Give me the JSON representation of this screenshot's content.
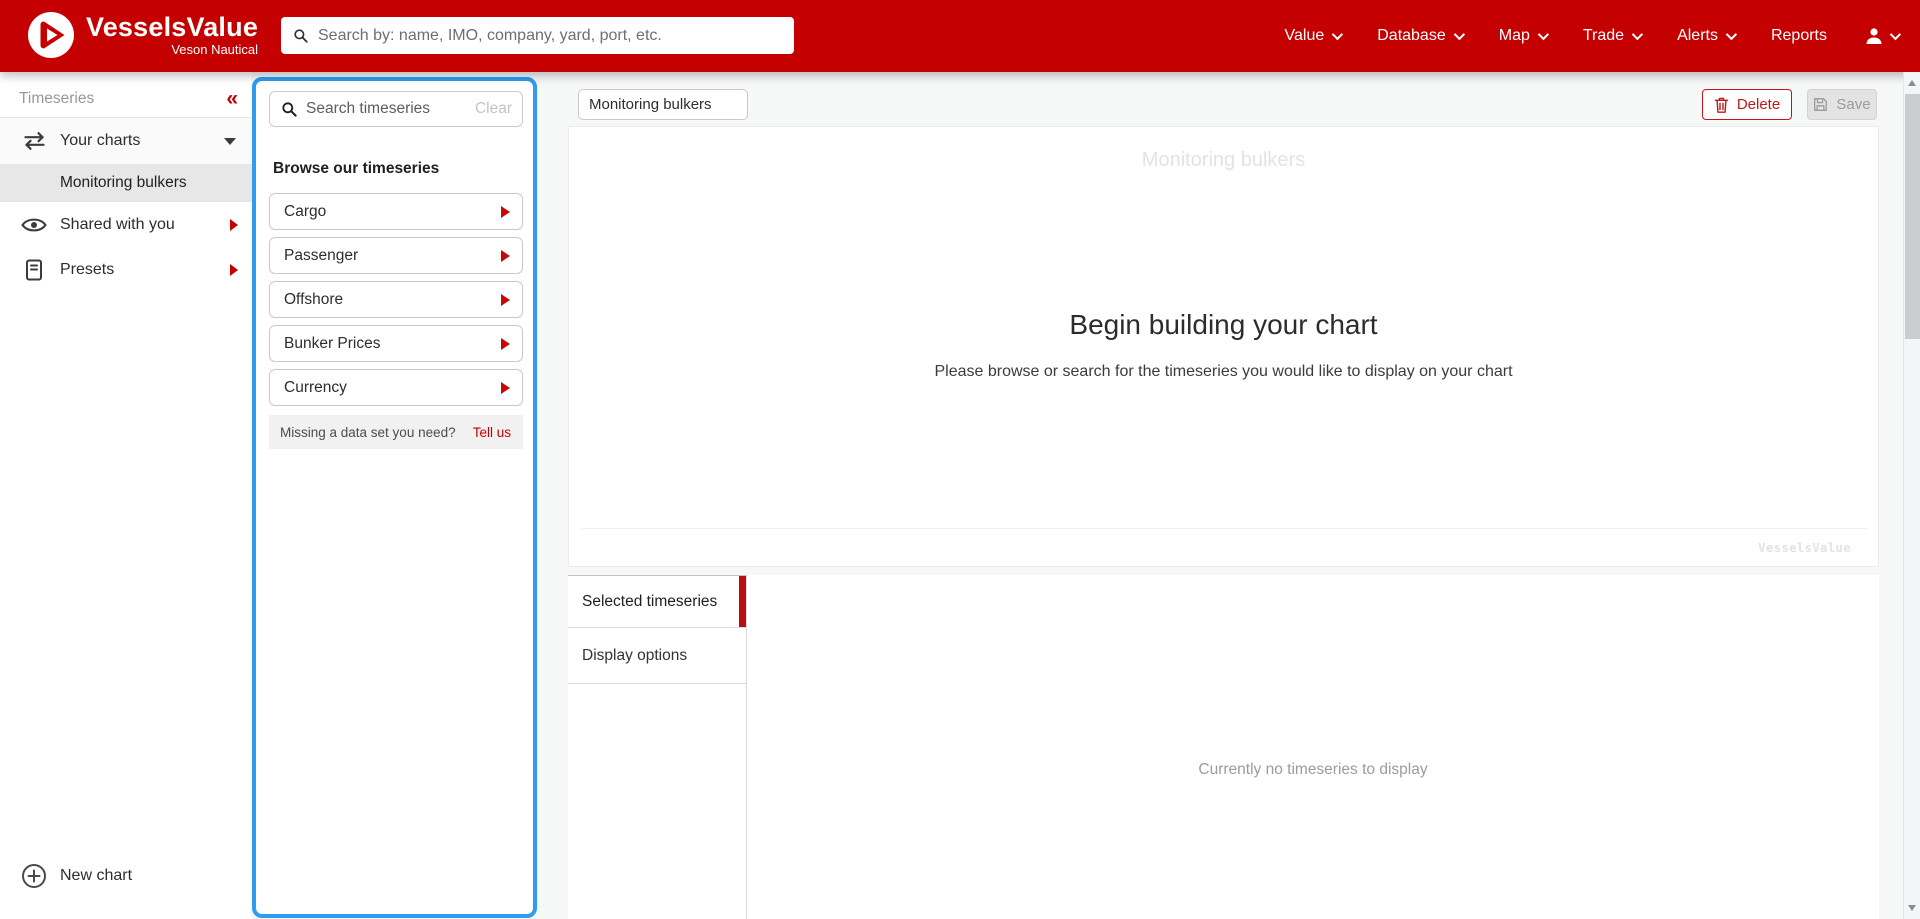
{
  "topbar": {
    "brand": {
      "name": "VesselsValue",
      "tagline": "Veson Nautical"
    },
    "search": {
      "placeholder": "Search by: name, IMO, company, yard, port, etc."
    },
    "nav": [
      {
        "label": "Value"
      },
      {
        "label": "Database"
      },
      {
        "label": "Map"
      },
      {
        "label": "Trade"
      },
      {
        "label": "Alerts"
      },
      {
        "label": "Reports"
      }
    ]
  },
  "sidebar": {
    "title": "Timeseries",
    "your_charts": "Your charts",
    "selected_chart": "Monitoring bulkers",
    "shared_with_you": "Shared with you",
    "presets": "Presets",
    "new_chart": "New chart"
  },
  "browse_panel": {
    "search_placeholder": "Search timeseries",
    "clear": "Clear",
    "heading": "Browse our timeseries",
    "categories": [
      {
        "label": "Cargo"
      },
      {
        "label": "Passenger"
      },
      {
        "label": "Offshore"
      },
      {
        "label": "Bunker Prices"
      },
      {
        "label": "Currency"
      }
    ],
    "missing_prompt": "Missing a data set you need?",
    "tell_us": "Tell us"
  },
  "workspace": {
    "chart_name": "Monitoring bulkers",
    "delete_label": "Delete",
    "save_label": "Save",
    "chart": {
      "watermark_title": "Monitoring bulkers",
      "empty_title": "Begin building your chart",
      "empty_subtitle": "Please browse or search for the timeseries you would like to display on your chart",
      "credits": "VesselsValue"
    },
    "tabs": [
      {
        "label": "Selected timeseries"
      },
      {
        "label": "Display options"
      }
    ],
    "empty_list": "Currently no timeseries to display"
  },
  "icons": {
    "collapse_glyph": "«"
  },
  "colors": {
    "brand_red": "#c50000",
    "accent_blue": "#2e9cf3",
    "tab_indicator_red": "#b90d11"
  }
}
